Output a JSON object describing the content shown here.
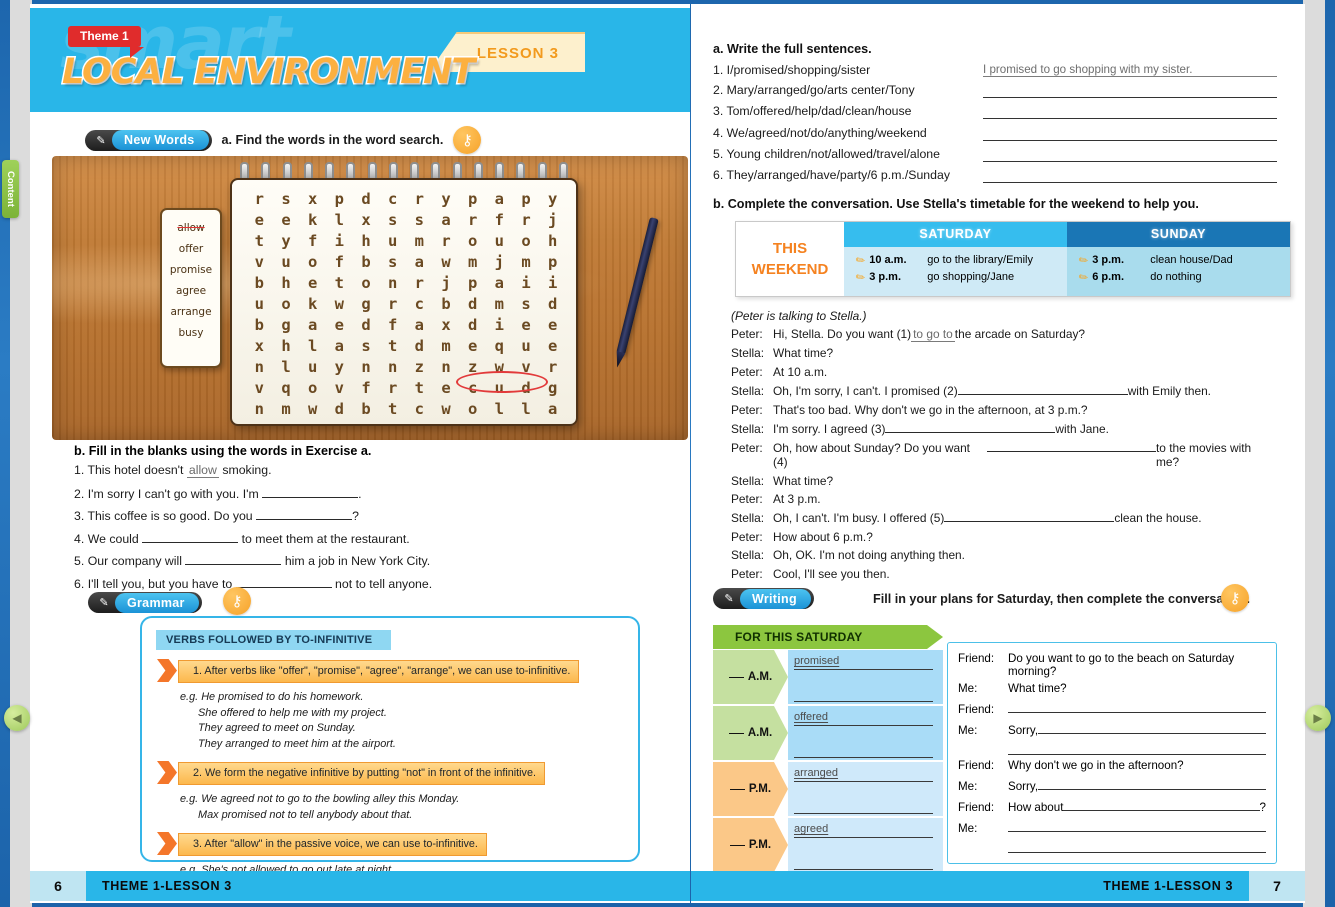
{
  "header": {
    "theme_badge": "Theme 1",
    "lesson_tab": "LESSON 3",
    "title": "LOCAL ENVIRONMENT",
    "ghost_text": "smart"
  },
  "left_page": {
    "new_words": {
      "pill_label": "New Words",
      "pill_icon": "abc-icon",
      "instruction": "a. Find the words in the word search.",
      "key_icon": "key-icon"
    },
    "word_search": {
      "grid": [
        [
          "r",
          "s",
          "x",
          "p",
          "d",
          "c",
          "r",
          "y",
          "p",
          "a",
          "p",
          "y"
        ],
        [
          "e",
          "e",
          "k",
          "l",
          "x",
          "s",
          "s",
          "a",
          "r",
          "f",
          "r",
          "j"
        ],
        [
          "t",
          "y",
          "f",
          "i",
          "h",
          "u",
          "m",
          "r",
          "o",
          "u",
          "o",
          "h"
        ],
        [
          "v",
          "u",
          "o",
          "f",
          "b",
          "s",
          "a",
          "w",
          "m",
          "j",
          "m",
          "p"
        ],
        [
          "b",
          "h",
          "e",
          "t",
          "o",
          "n",
          "r",
          "j",
          "p",
          "a",
          "i",
          "i"
        ],
        [
          "u",
          "o",
          "k",
          "w",
          "g",
          "r",
          "c",
          "b",
          "d",
          "m",
          "s",
          "d"
        ],
        [
          "b",
          "g",
          "a",
          "e",
          "d",
          "f",
          "a",
          "x",
          "d",
          "i",
          "e",
          "e"
        ],
        [
          "x",
          "h",
          "l",
          "a",
          "s",
          "t",
          "d",
          "m",
          "e",
          "q",
          "u",
          "e"
        ],
        [
          "n",
          "l",
          "u",
          "y",
          "n",
          "n",
          "z",
          "n",
          "z",
          "w",
          "v",
          "r"
        ],
        [
          "v",
          "q",
          "o",
          "v",
          "f",
          "r",
          "t",
          "e",
          "c",
          "u",
          "d",
          "g"
        ],
        [
          "n",
          "m",
          "w",
          "d",
          "b",
          "t",
          "c",
          "w",
          "o",
          "l",
          "l",
          "a"
        ]
      ],
      "found_word": "allow",
      "word_list": [
        {
          "word": "allow",
          "found": true
        },
        {
          "word": "offer",
          "found": false
        },
        {
          "word": "promise",
          "found": false
        },
        {
          "word": "agree",
          "found": false
        },
        {
          "word": "arrange",
          "found": false
        },
        {
          "word": "busy",
          "found": false
        }
      ]
    },
    "exercise_b": {
      "heading": "b. Fill in the blanks using the words in Exercise a.",
      "items": [
        {
          "num": "1.",
          "pre": "This hotel doesn't ",
          "answer": "allow",
          "post": " smoking.",
          "blank": false
        },
        {
          "num": "2.",
          "pre": "I'm sorry I can't go with you. I'm ",
          "answer": "",
          "post": ".",
          "blank": true
        },
        {
          "num": "3.",
          "pre": "This coffee is so good. Do you ",
          "answer": "",
          "post": "?",
          "blank": true
        },
        {
          "num": "4.",
          "pre": "We could ",
          "answer": "",
          "post": " to meet them at the restaurant.",
          "blank": true
        },
        {
          "num": "5.",
          "pre": "Our company will ",
          "answer": "",
          "post": " him a job in New York City.",
          "blank": true
        },
        {
          "num": "6.",
          "pre": "I'll tell you, but you have to ",
          "answer": "",
          "post": " not to tell anyone.",
          "blank": true
        }
      ]
    },
    "grammar": {
      "pill_label": "Grammar",
      "pill_icon": "pen-icon",
      "key_icon": "key-icon",
      "box_title": "VERBS FOLLOWED BY TO-INFINITIVE",
      "rule1": "1. After verbs like \"offer\", \"promise\", \"agree\", \"arrange\", we can use to-infinitive.",
      "examples1": [
        "e.g. He promised to do his homework.",
        "She offered to help me with my project.",
        "They agreed to meet on Sunday.",
        "They arranged to meet him at the airport."
      ],
      "rule2": "2. We form the negative infinitive by putting \"not\" in front of the infinitive.",
      "examples2": [
        "e.g. We agreed not to go to the bowling alley this Monday.",
        "Max promised not to tell anybody about that."
      ],
      "rule3": "3. After \"allow\" in the passive voice, we can use to-infinitive.",
      "examples3": [
        "e.g. She's not allowed to go out late at night."
      ]
    },
    "footer": {
      "page": "6",
      "label": "THEME 1-LESSON 3"
    }
  },
  "right_page": {
    "exercise_a": {
      "heading": "a. Write the full sentences.",
      "items": [
        {
          "num": "1.",
          "prompt": "I/promised/shopping/sister",
          "answer": "I promised to go shopping with my sister."
        },
        {
          "num": "2.",
          "prompt": "Mary/arranged/go/arts center/Tony",
          "answer": ""
        },
        {
          "num": "3.",
          "prompt": "Tom/offered/help/dad/clean/house",
          "answer": ""
        },
        {
          "num": "4.",
          "prompt": "We/agreed/not/do/anything/weekend",
          "answer": ""
        },
        {
          "num": "5.",
          "prompt": "Young children/not/allowed/travel/alone",
          "answer": ""
        },
        {
          "num": "6.",
          "prompt": "They/arranged/have/party/6 p.m./Sunday",
          "answer": ""
        }
      ]
    },
    "exercise_b": {
      "heading": "b. Complete the conversation. Use Stella's timetable for the weekend to help you.",
      "timetable": {
        "corner_line1": "THIS",
        "corner_line2": "WEEKEND",
        "saturday_label": "SATURDAY",
        "sunday_label": "SUNDAY",
        "saturday": [
          {
            "time": "10 a.m.",
            "activity": "go to the library/Emily"
          },
          {
            "time": "3 p.m.",
            "activity": "go shopping/Jane"
          }
        ],
        "sunday": [
          {
            "time": "3 p.m.",
            "activity": "clean house/Dad"
          },
          {
            "time": "6 p.m.",
            "activity": "do nothing"
          }
        ]
      },
      "stage_direction": "(Peter is talking to Stella.)",
      "dialogue": [
        {
          "who": "Peter:",
          "pre": "Hi, Stella. Do you want (1) ",
          "fill": "to go to",
          "post": " the arcade on Saturday?",
          "blank": false
        },
        {
          "who": "Stella:",
          "pre": "What time?",
          "fill": "",
          "post": "",
          "blank": false
        },
        {
          "who": "Peter:",
          "pre": "At 10 a.m.",
          "fill": "",
          "post": "",
          "blank": false
        },
        {
          "who": "Stella:",
          "pre": "Oh, I'm sorry, I can't. I promised (2) ",
          "fill": "",
          "post": " with Emily then.",
          "blank": true
        },
        {
          "who": "Peter:",
          "pre": "That's too bad. Why don't we go in the afternoon, at 3 p.m.?",
          "fill": "",
          "post": "",
          "blank": false
        },
        {
          "who": "Stella:",
          "pre": "I'm sorry. I agreed (3) ",
          "fill": "",
          "post": " with Jane.",
          "blank": true
        },
        {
          "who": "Peter:",
          "pre": "Oh, how about Sunday? Do you want (4) ",
          "fill": "",
          "post": " to the movies with me?",
          "blank": true
        },
        {
          "who": "Stella:",
          "pre": "What time?",
          "fill": "",
          "post": "",
          "blank": false
        },
        {
          "who": "Peter:",
          "pre": "At 3 p.m.",
          "fill": "",
          "post": "",
          "blank": false
        },
        {
          "who": "Stella:",
          "pre": "Oh, I can't. I'm busy. I offered (5) ",
          "fill": "",
          "post": " clean the house.",
          "blank": true
        },
        {
          "who": "Peter:",
          "pre": "How about 6 p.m.?",
          "fill": "",
          "post": "",
          "blank": false
        },
        {
          "who": "Stella:",
          "pre": "Oh, OK. I'm not doing anything then.",
          "fill": "",
          "post": "",
          "blank": false
        },
        {
          "who": "Peter:",
          "pre": "Cool, I'll see you then.",
          "fill": "",
          "post": "",
          "blank": false
        }
      ]
    },
    "writing": {
      "pill_label": "Writing",
      "pill_icon": "pencil-icon",
      "instruction": "Fill in your plans for Saturday, then complete the conversation.",
      "key_icon": "key-icon",
      "banner": "FOR THIS SATURDAY",
      "slots": [
        {
          "period": "A.M.",
          "verb": "promised",
          "tone": "am"
        },
        {
          "period": "A.M.",
          "verb": "offered",
          "tone": "am"
        },
        {
          "period": "P.M.",
          "verb": "arranged",
          "tone": "pm"
        },
        {
          "period": "P.M.",
          "verb": "agreed",
          "tone": "pm"
        }
      ],
      "conversation": [
        {
          "who": "Friend:",
          "text": "Do you want to go to the beach on Saturday morning?",
          "blank": false
        },
        {
          "who": "Me:",
          "text": "What time?",
          "blank": false
        },
        {
          "who": "Friend:",
          "text": "",
          "blank": true
        },
        {
          "who": "Me:",
          "text": "Sorry,",
          "blank": true
        },
        {
          "who": "",
          "text": "",
          "blank": true
        },
        {
          "who": "Friend:",
          "text": "Why don't we go in the afternoon?",
          "blank": false
        },
        {
          "who": "Me:",
          "text": "Sorry,",
          "blank": true
        },
        {
          "who": "Friend:",
          "text": "How about",
          "blank": true,
          "tail": "?"
        },
        {
          "who": "Me:",
          "text": "",
          "blank": true
        },
        {
          "who": "",
          "text": "",
          "blank": true
        }
      ]
    },
    "footer": {
      "page": "7",
      "label": "THEME 1-LESSON 3"
    }
  },
  "controls": {
    "content_tab": "Content",
    "prev_icon": "arrow-left-icon",
    "next_icon": "arrow-right-icon"
  }
}
